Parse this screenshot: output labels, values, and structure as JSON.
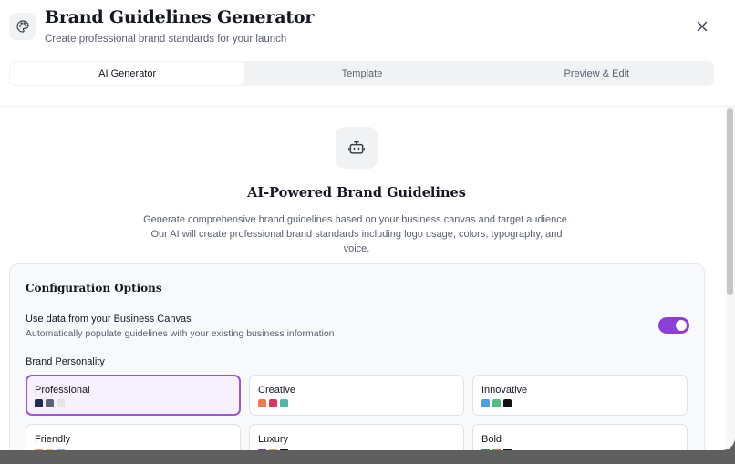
{
  "header": {
    "title": "Brand Guidelines Generator",
    "subtitle": "Create professional brand standards for your launch",
    "icon": "palette-icon",
    "close_icon": "close-icon"
  },
  "tabs": [
    {
      "label": "AI Generator",
      "active": true
    },
    {
      "label": "Template",
      "active": false
    },
    {
      "label": "Preview & Edit",
      "active": false
    }
  ],
  "hero": {
    "icon": "bot-icon",
    "title": "AI-Powered Brand Guidelines",
    "description": "Generate comprehensive brand guidelines based on your business canvas and target audience. Our AI will create professional brand standards including logo usage, colors, typography, and voice."
  },
  "config": {
    "title": "Configuration Options",
    "use_canvas": {
      "label": "Use data from your Business Canvas",
      "description": "Automatically populate guidelines with your existing business information",
      "enabled": true
    },
    "personality_label": "Brand Personality",
    "personalities": [
      {
        "name": "Professional",
        "selected": true,
        "colors": [
          "#1e2a5a",
          "#5a6478",
          "#e3e5ea"
        ]
      },
      {
        "name": "Creative",
        "selected": false,
        "colors": [
          "#ef7a4f",
          "#e0345f",
          "#4fb8a8"
        ]
      },
      {
        "name": "Innovative",
        "selected": false,
        "colors": [
          "#4aa3e0",
          "#4fbf7a",
          "#111111"
        ]
      },
      {
        "name": "Friendly",
        "selected": false,
        "colors": [
          "#f2a35a",
          "#f5c84c",
          "#8bcf6a"
        ]
      },
      {
        "name": "Luxury",
        "selected": false,
        "colors": [
          "#6b3fa0",
          "#d9a441",
          "#111111"
        ]
      },
      {
        "name": "Bold",
        "selected": false,
        "colors": [
          "#e0345f",
          "#f06a3a",
          "#111111"
        ]
      }
    ]
  },
  "colors": {
    "accent": "#8b3fd9",
    "selected_border": "#9a55e0",
    "selected_bg": "#f7f0fd"
  }
}
